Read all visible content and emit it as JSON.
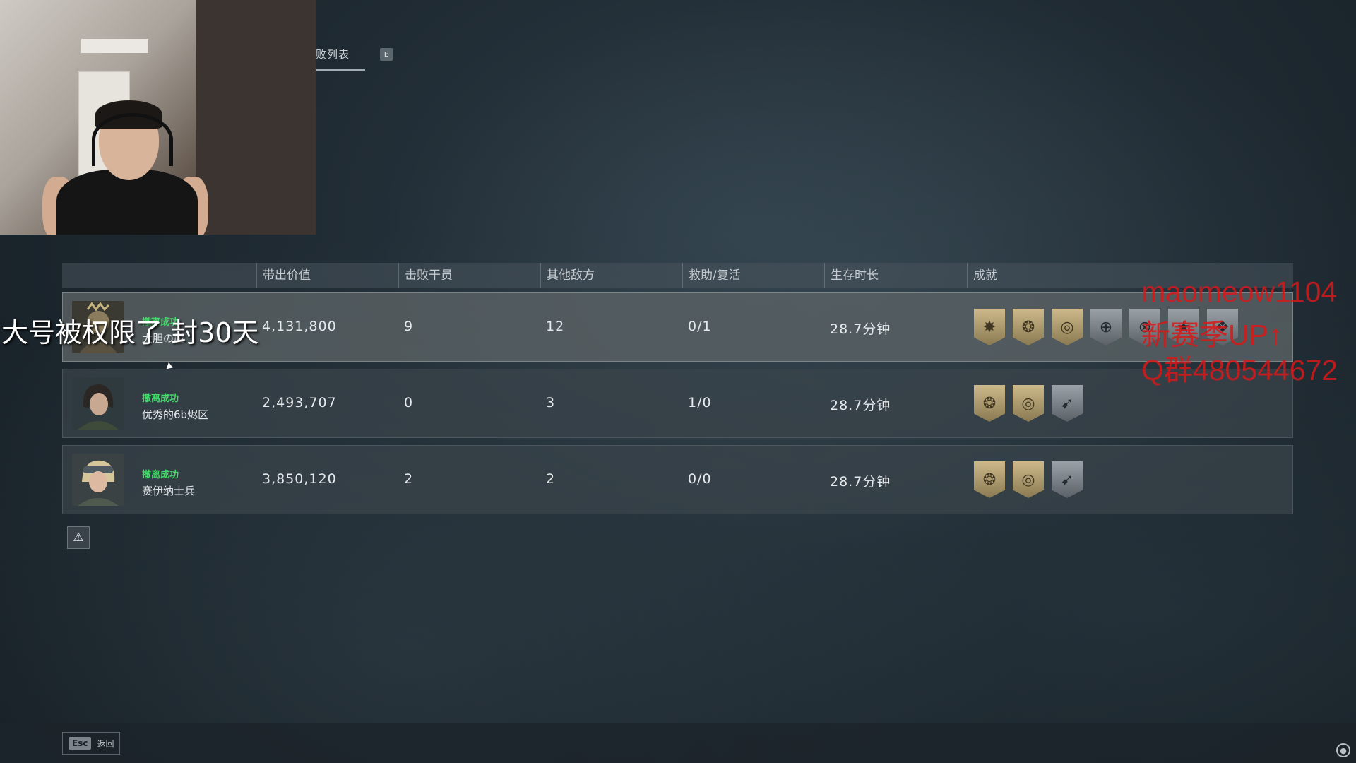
{
  "tab": {
    "label": "败列表",
    "hotkey": "E"
  },
  "table": {
    "headers": [
      "带出价值",
      "击败干员",
      "其他敌方",
      "救助/复活",
      "生存时长",
      "成就"
    ],
    "rows": [
      {
        "status": "撤离成功",
        "name": "大胆の魔",
        "value": "4,131,800",
        "kills": "9",
        "others": "12",
        "assists": "0/1",
        "survival": "28.7分钟",
        "badges": [
          "gold",
          "gold",
          "gold",
          "silver",
          "silver",
          "silver",
          "silver"
        ]
      },
      {
        "status": "撤离成功",
        "name": "优秀的6b烬区",
        "value": "2,493,707",
        "kills": "0",
        "others": "3",
        "assists": "1/0",
        "survival": "28.7分钟",
        "badges": [
          "gold",
          "gold",
          "silver"
        ]
      },
      {
        "status": "撤离成功",
        "name": "赛伊纳士兵",
        "value": "3,850,120",
        "kills": "2",
        "others": "2",
        "assists": "0/0",
        "survival": "28.7分钟",
        "badges": [
          "gold",
          "gold",
          "silver"
        ]
      }
    ]
  },
  "overlay": {
    "caption": "大号被权限了 封30天"
  },
  "promo": {
    "line1": "maomeow1104",
    "line2": "新赛季UP↑",
    "line3": "Q群480544672"
  },
  "footer": {
    "esc_key": "Esc",
    "back_label": "返回"
  },
  "icons": {
    "warning": "warning-icon",
    "corner": "settings-icon",
    "cursor": "mouse-cursor"
  },
  "colors": {
    "success": "#45d86a",
    "promo": "#d71919",
    "gold_badge": "#cdb98a",
    "silver_badge": "#9aa2a8"
  }
}
